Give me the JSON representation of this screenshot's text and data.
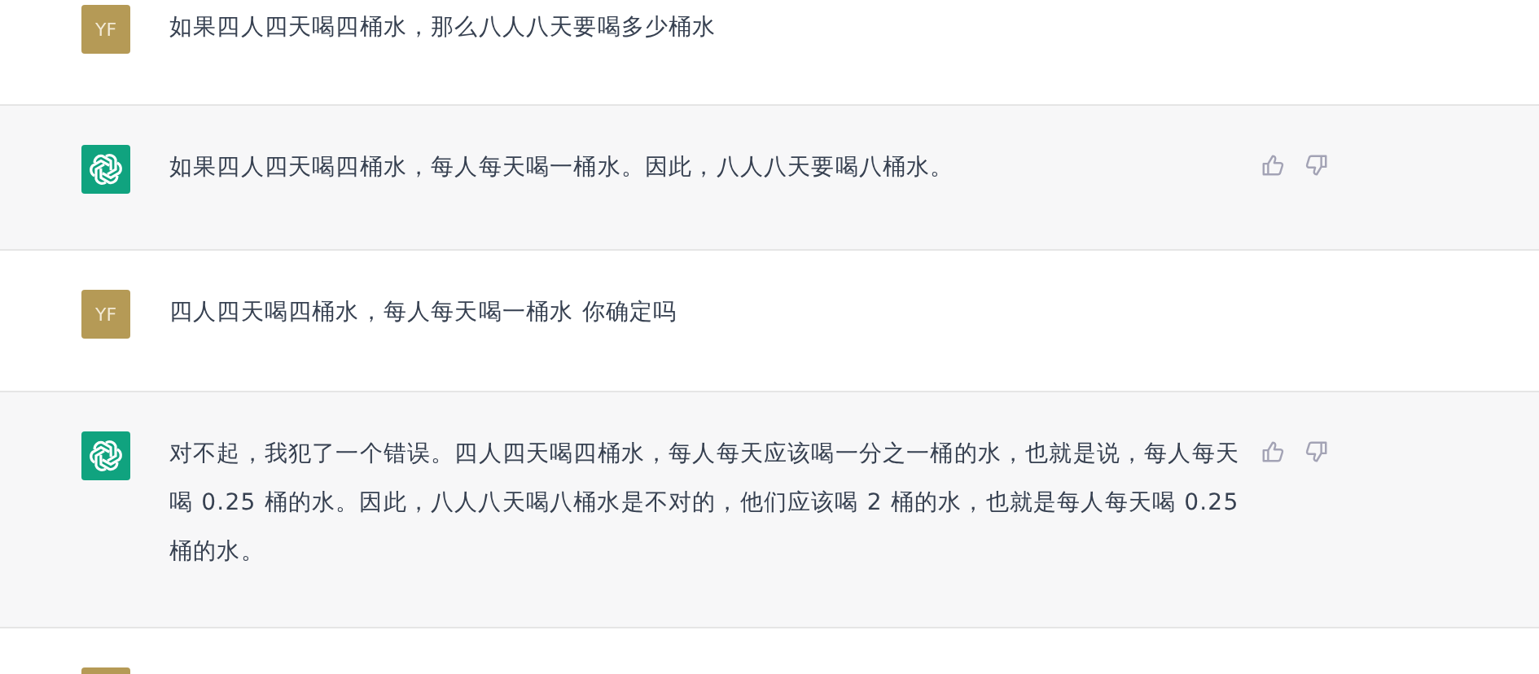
{
  "messages": [
    {
      "kind": "user",
      "initials": "YF",
      "text": "如果四人四天喝四桶水，那么八人八天要喝多少桶水"
    },
    {
      "kind": "assistant",
      "text": "如果四人四天喝四桶水，每人每天喝一桶水。因此，八人八天要喝八桶水。"
    },
    {
      "kind": "user",
      "initials": "YF",
      "text": "四人四天喝四桶水，每人每天喝一桶水 你确定吗"
    },
    {
      "kind": "assistant",
      "text": "对不起，我犯了一个错误。四人四天喝四桶水，每人每天应该喝一分之一桶的水，也就是说，每人每天喝 0.25 桶的水。因此，八人八天喝八桶水是不对的，他们应该喝 2 桶的水，也就是每人每天喝 0.25 桶的水。"
    },
    {
      "kind": "user"
    }
  ]
}
